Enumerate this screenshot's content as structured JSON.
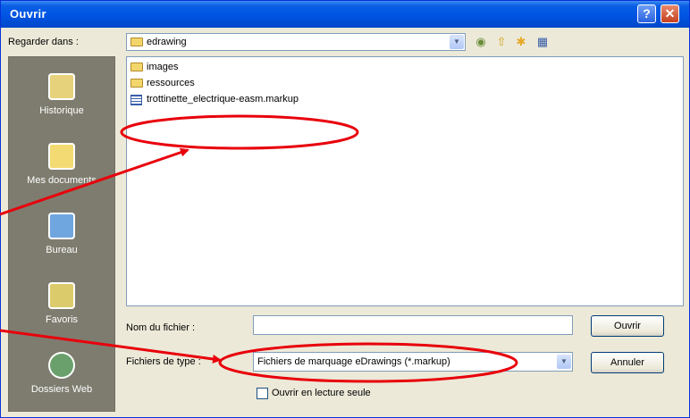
{
  "window": {
    "title": "Ouvrir",
    "help_symbol": "?",
    "close_symbol": "✕"
  },
  "lookin": {
    "label": "Regarder dans :",
    "value": "edrawing"
  },
  "toolbar": {
    "back_icon": "back-icon",
    "up_icon": "up-folder-icon",
    "newfolder_icon": "new-folder-icon",
    "views_icon": "views-menu-icon"
  },
  "places": [
    {
      "label": "Historique",
      "icon": "history-icon"
    },
    {
      "label": "Mes documents",
      "icon": "my-documents-icon"
    },
    {
      "label": "Bureau",
      "icon": "desktop-icon"
    },
    {
      "label": "Favoris",
      "icon": "favorites-icon"
    },
    {
      "label": "Dossiers Web",
      "icon": "web-folders-icon"
    }
  ],
  "files": [
    {
      "name": "images",
      "type": "folder"
    },
    {
      "name": "ressources",
      "type": "folder"
    },
    {
      "name": "trottinette_electrique-easm.markup",
      "type": "file"
    }
  ],
  "filename": {
    "label": "Nom du fichier :",
    "value": ""
  },
  "filetype": {
    "label": "Fichiers de type :",
    "value": "Fichiers de marquage eDrawings (*.markup)"
  },
  "buttons": {
    "open": "Ouvrir",
    "cancel": "Annuler"
  },
  "readonly": {
    "label": "Ouvrir en lecture seule",
    "checked": false
  },
  "annotation": {
    "color": "#e8000b"
  }
}
